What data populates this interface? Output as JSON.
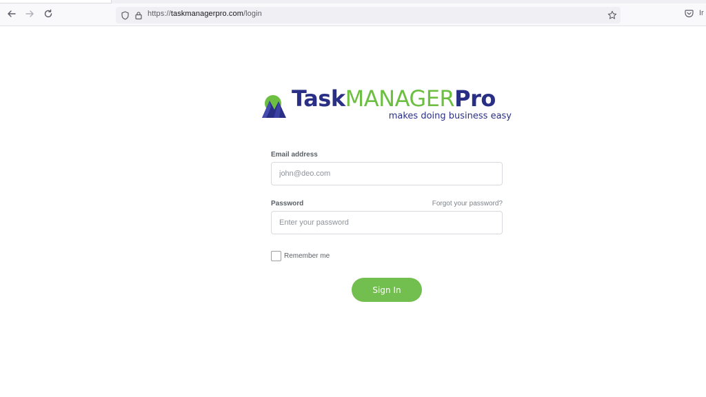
{
  "browser": {
    "url_scheme": "https://",
    "url_host": "taskmanagerpro.com",
    "url_path": "/login",
    "right_text": "Ir"
  },
  "logo": {
    "word_task": "Task",
    "word_manager": "MANAGER",
    "word_pro": "Pro",
    "tagline": "makes doing business easy",
    "colors": {
      "primary": "#2a2f86",
      "accent": "#6cbf40"
    }
  },
  "form": {
    "email_label": "Email address",
    "email_placeholder": "john@deo.com",
    "email_value": "",
    "password_label": "Password",
    "password_placeholder": "Enter your password",
    "password_value": "",
    "forgot_link": "Forgot your password?",
    "remember_label": "Remember me",
    "remember_checked": false,
    "signin_label": "Sign In",
    "signin_color": "#72bf4f"
  },
  "icons": [
    "back-arrow-icon",
    "forward-arrow-icon",
    "reload-icon",
    "shield-icon",
    "lock-icon",
    "star-icon",
    "pocket-icon"
  ]
}
